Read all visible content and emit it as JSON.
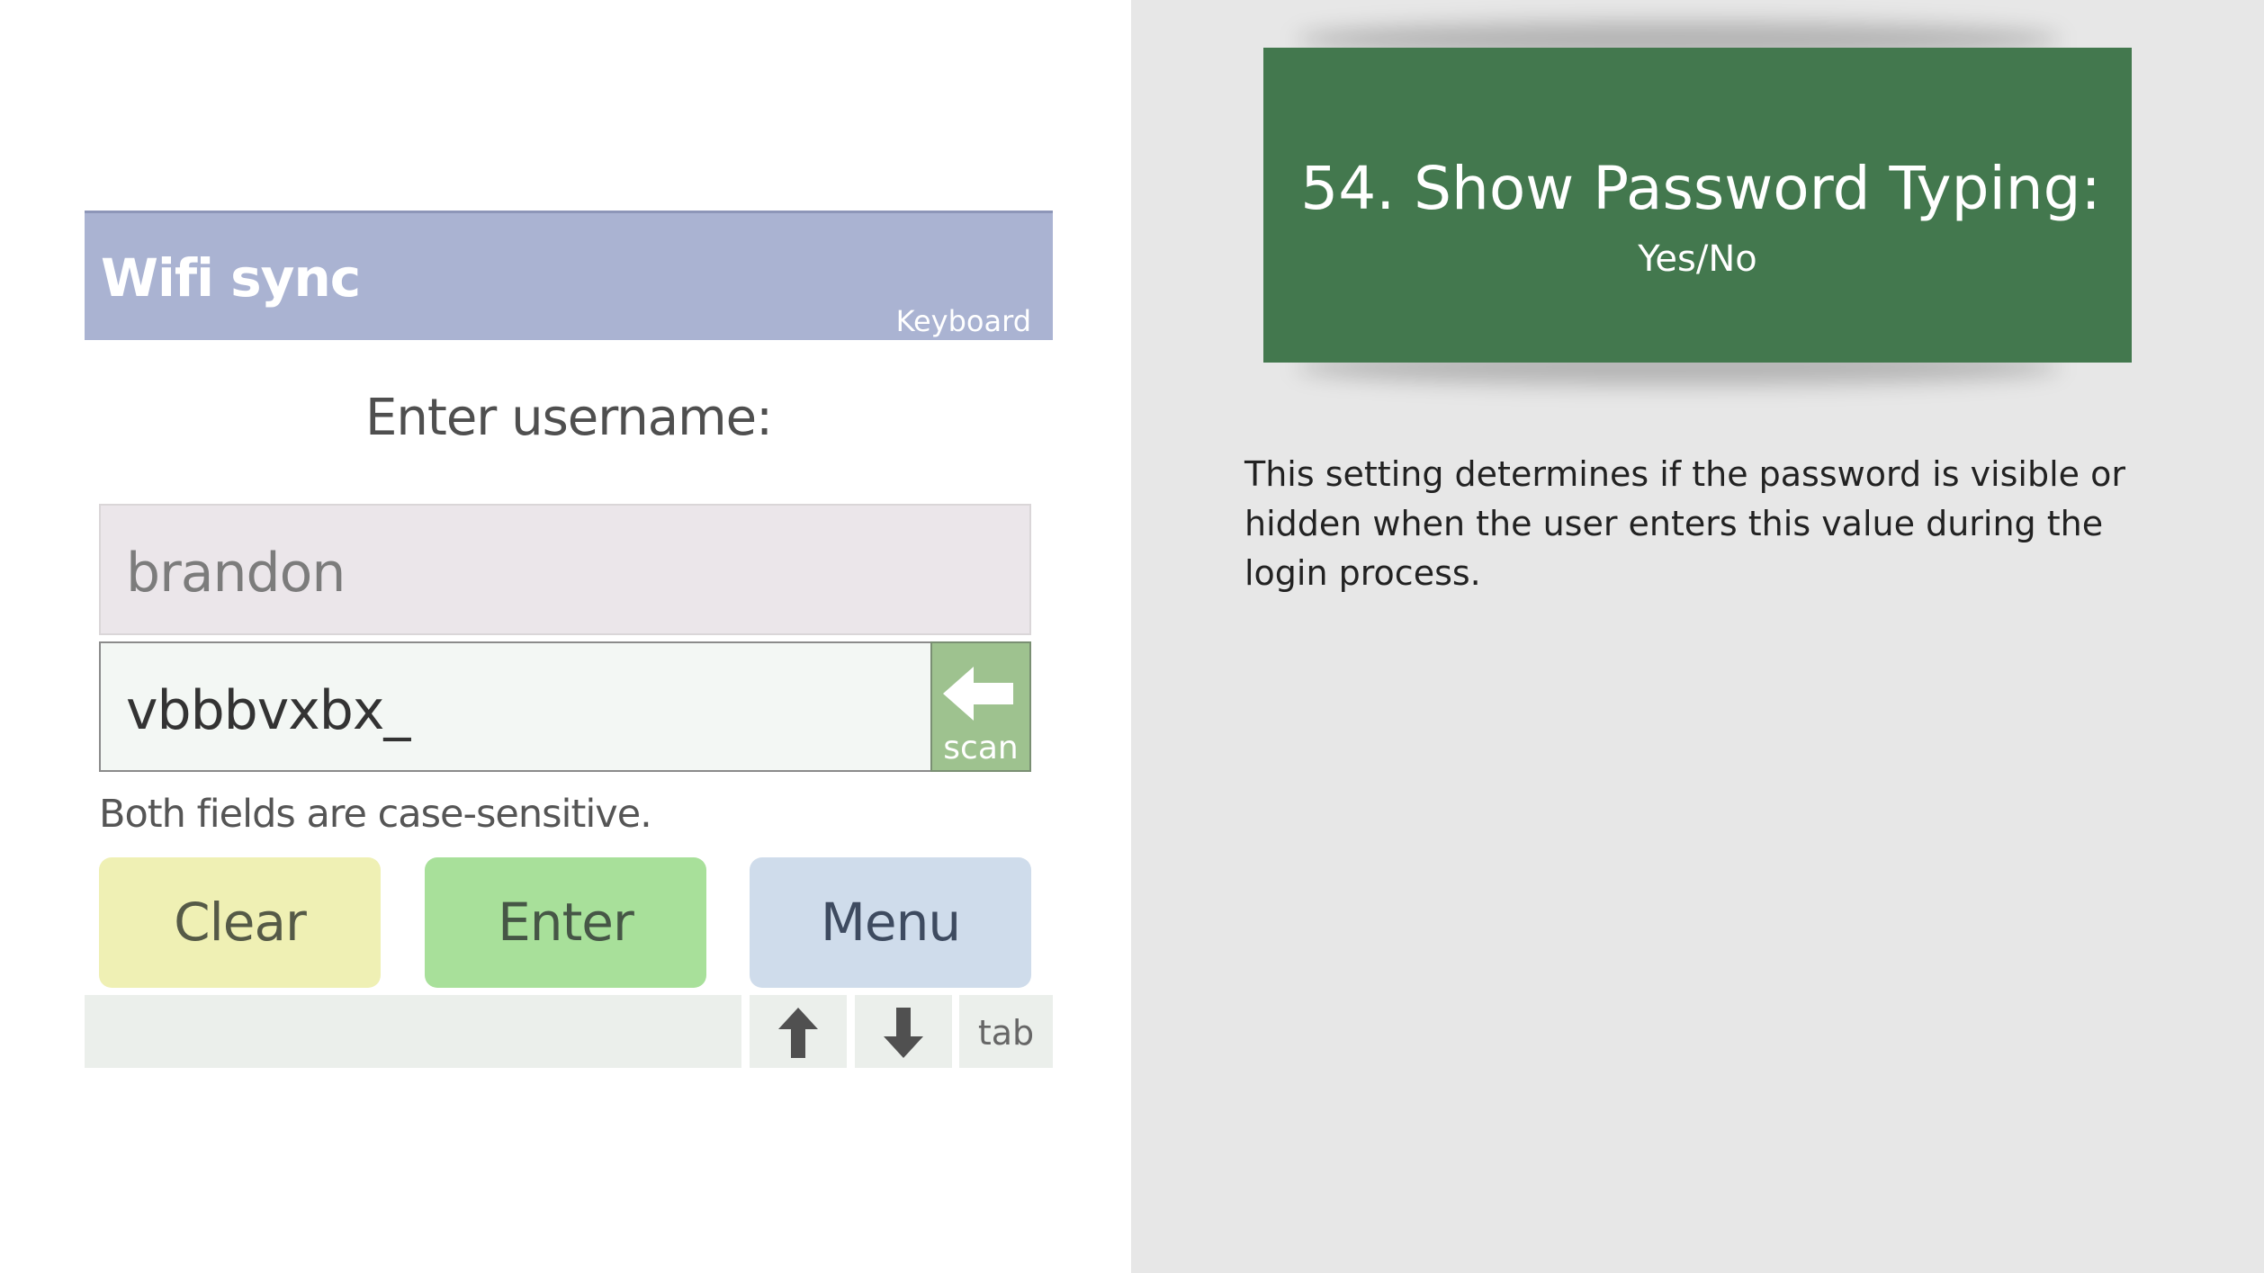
{
  "device": {
    "app_title": "Wifi sync",
    "keyboard_label": "Keyboard",
    "prompt": "Enter username:",
    "username_value": "brandon",
    "password_value": "vbbbvxbx_",
    "scan_label": "scan",
    "hint": "Both fields are case-sensitive.",
    "buttons": {
      "clear": "Clear",
      "enter": "Enter",
      "menu": "Menu"
    },
    "keys": {
      "up_icon": "arrow-up-icon",
      "down_icon": "arrow-down-icon",
      "tab": "tab"
    },
    "colors": {
      "title_bar": "#aab3d2",
      "clear": "#eff0b4",
      "enter": "#a8e09a",
      "menu": "#cfdceb",
      "scan": "#9ec28f"
    }
  },
  "slide": {
    "title": "54. Show Password Typing:",
    "subtitle": "Yes/No",
    "description": "This setting determines if the password is visible or hidden when the user enters this value during the login process.",
    "colors": {
      "banner": "#43784e",
      "background": "#e7e7e7"
    }
  }
}
